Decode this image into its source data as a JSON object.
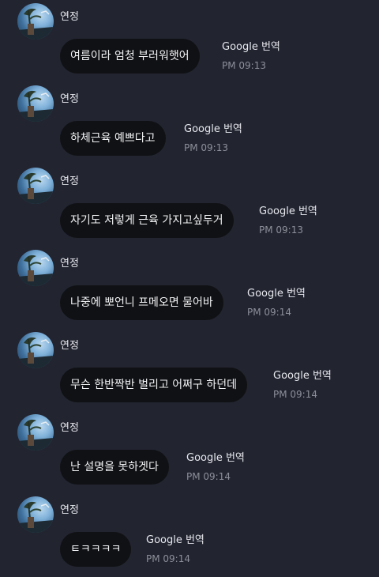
{
  "chat": {
    "messages": [
      {
        "sender": "연정",
        "text": "여름이라 엄청 부러워햇어",
        "translate": "Google 번역",
        "time": "PM 09:13"
      },
      {
        "sender": "연정",
        "text": "하체근육 예쁘다고",
        "translate": "Google 번역",
        "time": "PM 09:13"
      },
      {
        "sender": "연정",
        "text": "자기도 저렇게 근육 가지고싶두거",
        "translate": "Google 번역",
        "time": "PM 09:13"
      },
      {
        "sender": "연정",
        "text": "나중에 뽀언니 프메오면 물어바",
        "translate": "Google 번역",
        "time": "PM 09:14"
      },
      {
        "sender": "연정",
        "text": "무슨 한반짝반 벌리고 어쩌구 하던데",
        "translate": "Google 번역",
        "time": "PM 09:14"
      },
      {
        "sender": "연정",
        "text": "난 설명을 못하겟다",
        "translate": "Google 번역",
        "time": "PM 09:14"
      },
      {
        "sender": "연정",
        "text": "ㅌㅋㅋㅋㅋ",
        "translate": "Google 번역",
        "time": "PM 09:14"
      }
    ]
  }
}
